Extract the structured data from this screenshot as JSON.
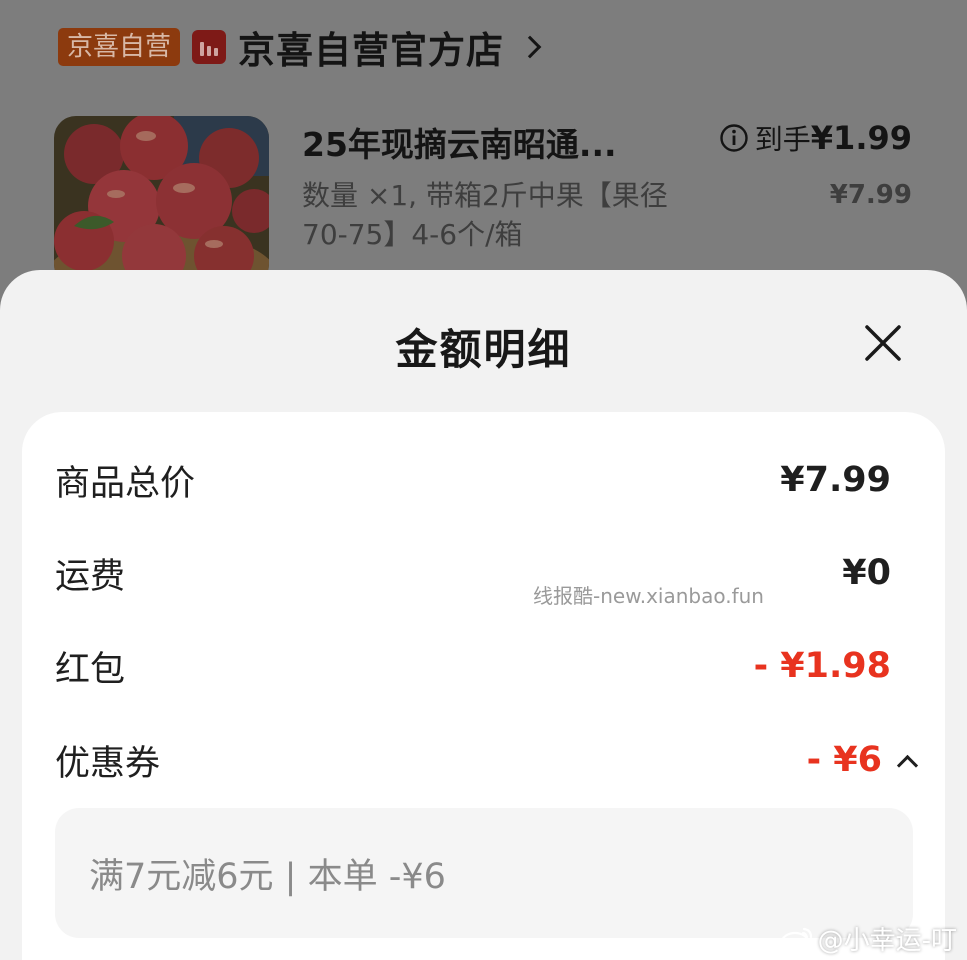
{
  "store": {
    "badge": "京喜自营",
    "name": "京喜自营官方店"
  },
  "product": {
    "title": "25年现摘云南昭通...",
    "spec": "数量 ×1, 带箱2斤中果【果径70-75】4-6个/箱",
    "final_label": "到手",
    "final_price": "¥1.99",
    "original_price": "¥7.99"
  },
  "sheet": {
    "title": "金额明细",
    "rows": [
      {
        "label": "商品总价",
        "value": "¥7.99"
      },
      {
        "label": "运费",
        "value": "¥0"
      },
      {
        "label": "红包",
        "value": "- ¥1.98"
      },
      {
        "label": "优惠券",
        "value": "- ¥6"
      }
    ],
    "coupon_detail": "满7元减6元 | 本单 -¥6"
  },
  "overlay": {
    "watermark": "线报酷-new.xianbao.fun",
    "credit": "@小幸运-叮"
  },
  "colors": {
    "accent_red": "#e8331f",
    "sheet_bg": "#f2f2f2",
    "card_bg": "#ffffff",
    "dim_overlay": "#7d7d7d"
  },
  "icons": [
    "chevron-right-icon",
    "info-icon",
    "close-icon",
    "chevron-up-icon",
    "weibo-icon"
  ]
}
